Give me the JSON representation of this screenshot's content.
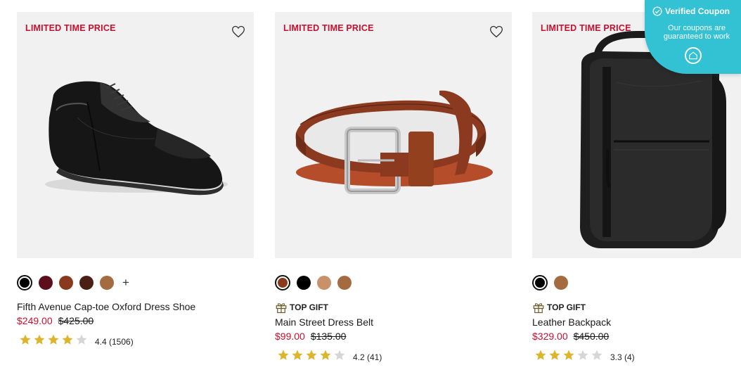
{
  "colors": {
    "promo_red": "#c8102e",
    "image_bg": "#f1f1f1",
    "star_gold": "#dcb52c",
    "star_empty": "#d6d6d6",
    "coupon_bg": "#33c2d4"
  },
  "coupon": {
    "title": "Verified Coupon",
    "subtitle": "Our coupons are guaranteed to work",
    "icon": "check-circle-icon",
    "button_icon": "home-icon"
  },
  "products": [
    {
      "promo_label": "LIMITED TIME PRICE",
      "image_alt": "Fifth Avenue Cap-toe Oxford Dress Shoe",
      "swatches": [
        "#000000",
        "#5c0f1a",
        "#8a3a1c",
        "#4a1f14",
        "#a46b41"
      ],
      "selected_swatch": 0,
      "more_label": "+",
      "badge": "",
      "name": "Fifth Avenue Cap-toe Oxford Dress Shoe",
      "sale_price": "$249.00",
      "original_price": "$425.00",
      "rating": 4.4,
      "rating_text": "4.4 (1506)"
    },
    {
      "promo_label": "LIMITED TIME PRICE",
      "image_alt": "Main Street Dress Belt",
      "swatches": [
        "#8a3a1c",
        "#000000",
        "#c7926a",
        "#a46b41"
      ],
      "selected_swatch": 0,
      "more_label": "",
      "badge": "TOP GIFT",
      "name": "Main Street Dress Belt",
      "sale_price": "$99.00",
      "original_price": "$135.00",
      "rating": 4.2,
      "rating_text": "4.2 (41)"
    },
    {
      "promo_label": "LIMITED TIME PRICE",
      "image_alt": "Leather Backpack",
      "swatches": [
        "#000000",
        "#a46b41"
      ],
      "selected_swatch": 0,
      "more_label": "",
      "badge": "TOP GIFT",
      "name": "Leather Backpack",
      "sale_price": "$329.00",
      "original_price": "$450.00",
      "rating": 3.3,
      "rating_text": "3.3 (4)"
    }
  ]
}
